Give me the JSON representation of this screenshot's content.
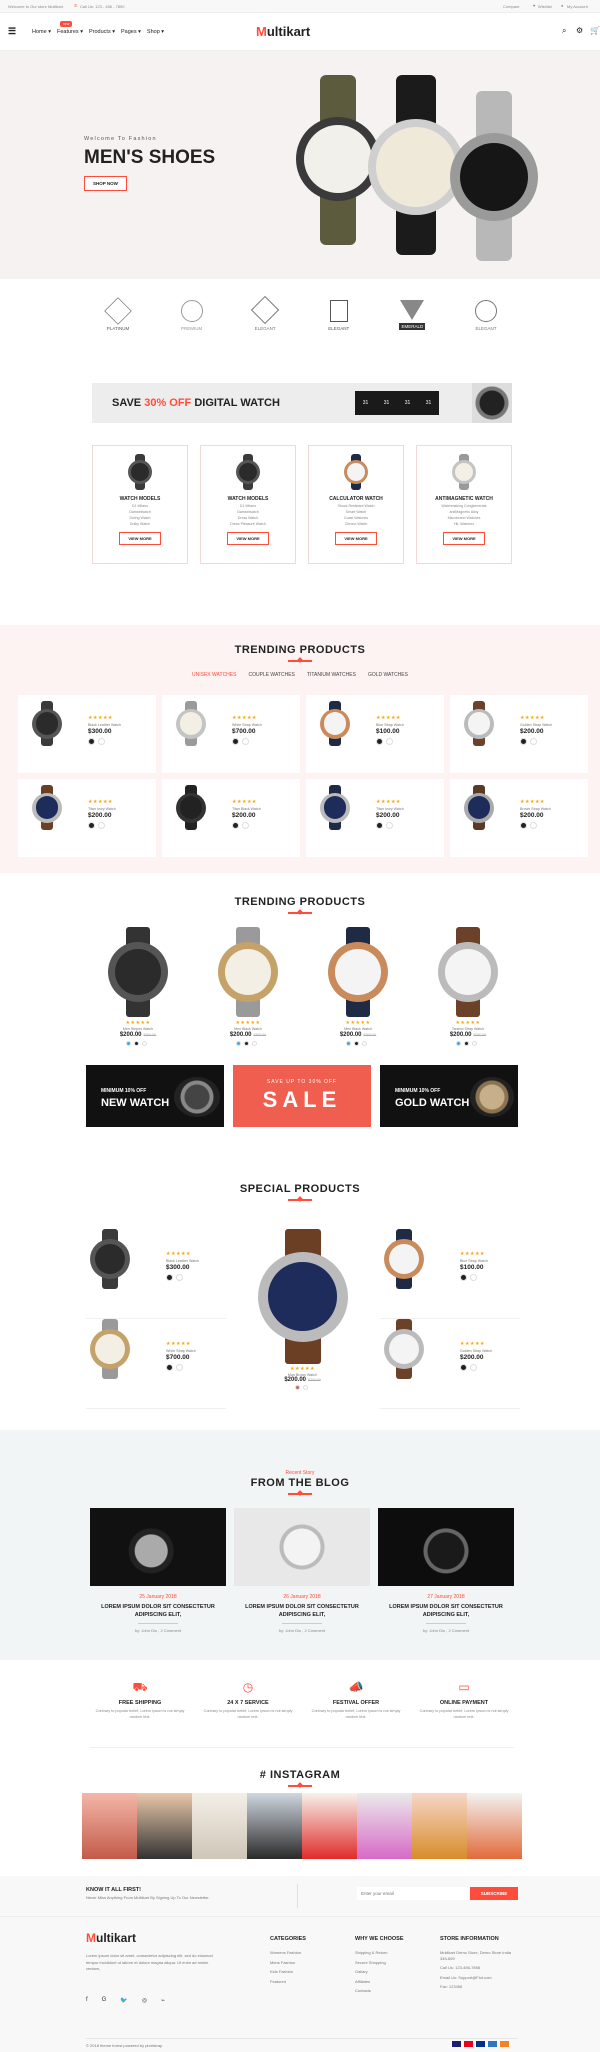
{
  "topbar": {
    "welcome": "Welcome to Our store Multikart",
    "phone": "Call Us: 123 - 456 - 7890",
    "compare": "Compare",
    "wishlist": "Wishlist",
    "account": "My Account"
  },
  "nav": {
    "logo_m": "M",
    "logo_rest": "ultikart",
    "items": [
      "Home",
      "Features",
      "Products",
      "Pages",
      "Shop"
    ],
    "new_badge": "new",
    "cart_count": "0"
  },
  "hero": {
    "kicker": "Welcome To Fashion",
    "title": "MEN'S SHOES",
    "button": "SHOP NOW"
  },
  "brands": [
    "PLATINUM",
    "PREMIUM",
    "ELEGANT",
    "ELEGANT",
    "EMERALD",
    "ELEGANT"
  ],
  "promo": {
    "left": "SAVE",
    "pct": "30% OFF",
    "right": "DIGITAL WATCH",
    "timer": [
      "31",
      "31",
      "31",
      "31"
    ]
  },
  "categories": [
    {
      "title": "WATCH MODELS",
      "items": [
        "D1 Milano",
        "Damselwatch",
        "Diving Watch",
        "Dolby Watch"
      ],
      "button": "VIEW MORE"
    },
    {
      "title": "WATCH MODELS",
      "items": [
        "D1 Milano",
        "Damselwatch",
        "Dress Watch",
        "Dress Pleasure Watch"
      ],
      "button": "VIEW MORE"
    },
    {
      "title": "CALCULATOR WATCH",
      "items": [
        "Shock Resistant Watch",
        "Smart Watch",
        "Coast Watches",
        "Chrono Watch"
      ],
      "button": "VIEW MORE"
    },
    {
      "title": "ANTIMAGNETIC WATCH",
      "items": [
        "Watchmaking Conglomerate",
        "antiMagnetic Alloy",
        "Microbrand Watches",
        "HiL Watches"
      ],
      "button": "VIEW MORE"
    }
  ],
  "trending1": {
    "title": "TRENDING PRODUCTS",
    "tabs": [
      "UNISEX WATCHES",
      "COUPLE WATCHES",
      "TITANIUM WATCHES",
      "GOLD WATCHES"
    ],
    "products": [
      {
        "name": "Black Leather Watch",
        "price": "$300.00"
      },
      {
        "name": "White Strap Watch",
        "price": "$700.00"
      },
      {
        "name": "Blue Strap Watch",
        "price": "$100.00"
      },
      {
        "name": "Golden Strap Watch",
        "price": "$200.00"
      },
      {
        "name": "Titan Ivory Watch",
        "price": "$200.00"
      },
      {
        "name": "Titan Black Watch",
        "price": "$200.00"
      },
      {
        "name": "Titan Ivory Watch",
        "price": "$200.00"
      },
      {
        "name": "Brown Strap Watch",
        "price": "$200.00"
      }
    ]
  },
  "trending2": {
    "title": "TRENDING PRODUCTS",
    "products": [
      {
        "name": "Men Stripes Watch",
        "price": "$200.00",
        "old": "$300.00"
      },
      {
        "name": "Men Black Watch",
        "price": "$200.00",
        "old": "$300.00"
      },
      {
        "name": "Men Black Watch",
        "price": "$200.00",
        "old": "$300.00"
      },
      {
        "name": "Tanked Strap Watch",
        "price": "$200.00",
        "old": "$300.00"
      }
    ]
  },
  "banners": [
    {
      "small": "MINIMUM 10% OFF",
      "big": "NEW WATCH"
    },
    {
      "small": "SAVE UP TO 30% OFF",
      "big": "SALE"
    },
    {
      "small": "MINIMUM 10% OFF",
      "big": "GOLD WATCH"
    }
  ],
  "special": {
    "title": "SPECIAL PRODUCTS",
    "left": [
      {
        "name": "Black Leather Watch",
        "price": "$300.00"
      },
      {
        "name": "White Strap Watch",
        "price": "$700.00"
      }
    ],
    "center": {
      "name": "Man Brown Watch",
      "price": "$200.00",
      "old": "$300.00"
    },
    "right": [
      {
        "name": "Blue Strap Watch",
        "price": "$100.00"
      },
      {
        "name": "Golden Strap Watch",
        "price": "$200.00"
      }
    ]
  },
  "blog": {
    "kicker": "Recent Story",
    "title": "FROM THE BLOG",
    "posts": [
      {
        "date": "25 January 2018",
        "text": "LOREM IPSUM DOLOR SIT CONSECTETUR ADIPISCING ELIT,",
        "meta": "by: John Dio , 2 Comment"
      },
      {
        "date": "26 January 2018",
        "text": "LOREM IPSUM DOLOR SIT CONSECTETUR ADIPISCING ELIT,",
        "meta": "by: John Dio , 2 Comment"
      },
      {
        "date": "27 January 2018",
        "text": "LOREM IPSUM DOLOR SIT CONSECTETUR ADIPISCING ELIT,",
        "meta": "by: John Dio , 2 Comment"
      }
    ]
  },
  "services": [
    {
      "title": "FREE SHIPPING",
      "text": "Contrary to popular belief, Lorem Ipsum is not simply random text."
    },
    {
      "title": "24 X 7 SERVICE",
      "text": "Contrary to popular belief, Lorem Ipsum is not simply random text."
    },
    {
      "title": "FESTIVAL OFFER",
      "text": "Contrary to popular belief, Lorem Ipsum is not simply random text."
    },
    {
      "title": "ONLINE PAYMENT",
      "text": "Contrary to popular belief, Lorem Ipsum is not simply random text."
    }
  ],
  "instagram": {
    "title": "# INSTAGRAM"
  },
  "newsletter": {
    "title": "KNOW IT ALL FIRST!",
    "text": "Never Miss Anything From Multikart By Signing Up To Our Newsletter.",
    "placeholder": "Enter your email",
    "button": "SUBSCRIBE"
  },
  "footer": {
    "about": "Lorem ipsum dolor sit amet, consectetur adipiscing elit, sed do eiusmod tempor incididunt ut labore et dolore magna aliqua. Ut enim ad minim veniam,",
    "col1_title": "CATEGORIES",
    "col1": [
      "Womens Fashion",
      "Mens Fashion",
      "Kids Fashion",
      "Featured"
    ],
    "col2_title": "WHY WE CHOOSE",
    "col2": [
      "Shipping & Return",
      "Secure Shopping",
      "Gallary",
      "Affiliates",
      "Contacts"
    ],
    "col3_title": "STORE INFORMATION",
    "col3": [
      "Multikart Demo Store, Demo Store India 345-659",
      "Call Us: 123-456-7898",
      "Email Us: Support@Fiot.com",
      "Fax: 123456"
    ],
    "copyright": "© 2018 theme forest powered by pixelstrap"
  },
  "colors": {
    "accent": "#ff4c3b",
    "hero_bg": "#f7f2f2",
    "pink_bg": "#fdf3f2",
    "blog_bg": "#f1f5f5"
  }
}
